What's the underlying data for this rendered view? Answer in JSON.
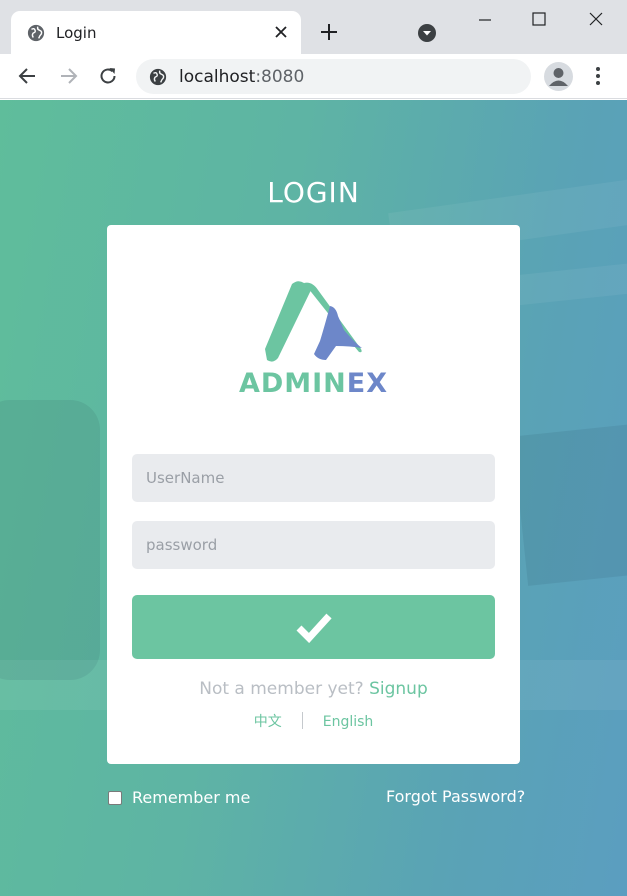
{
  "browser": {
    "tab_title": "Login",
    "url_host": "localhost",
    "url_port": ":8080"
  },
  "icons": {
    "tab": "globe-icon",
    "close_tab": "close-icon",
    "new_tab": "plus-icon",
    "tab_search": "chevron-down-circle-icon",
    "minimize": "minimize-icon",
    "maximize": "maximize-icon",
    "close_window": "close-icon",
    "back": "arrow-left-icon",
    "forward": "arrow-right-icon",
    "reload": "reload-icon",
    "site_info": "globe-icon",
    "profile": "user-icon",
    "menu": "more-vertical-icon",
    "submit": "check-icon"
  },
  "page": {
    "heading": "LOGIN",
    "brand_part1": "ADMIN",
    "brand_part2": "EX",
    "username_placeholder": "UserName",
    "password_placeholder": "password",
    "not_member_text": "Not a member yet?",
    "signup_link": "Signup",
    "lang_chinese": "中文",
    "lang_english": "English",
    "remember_label": "Remember me",
    "forgot_link": "Forgot Password?"
  },
  "colors": {
    "accent_green": "#6cc5a1",
    "accent_blue": "#6d87c9",
    "background_gradient_start": "#5fbd9b",
    "background_gradient_end": "#5b9ec0"
  }
}
